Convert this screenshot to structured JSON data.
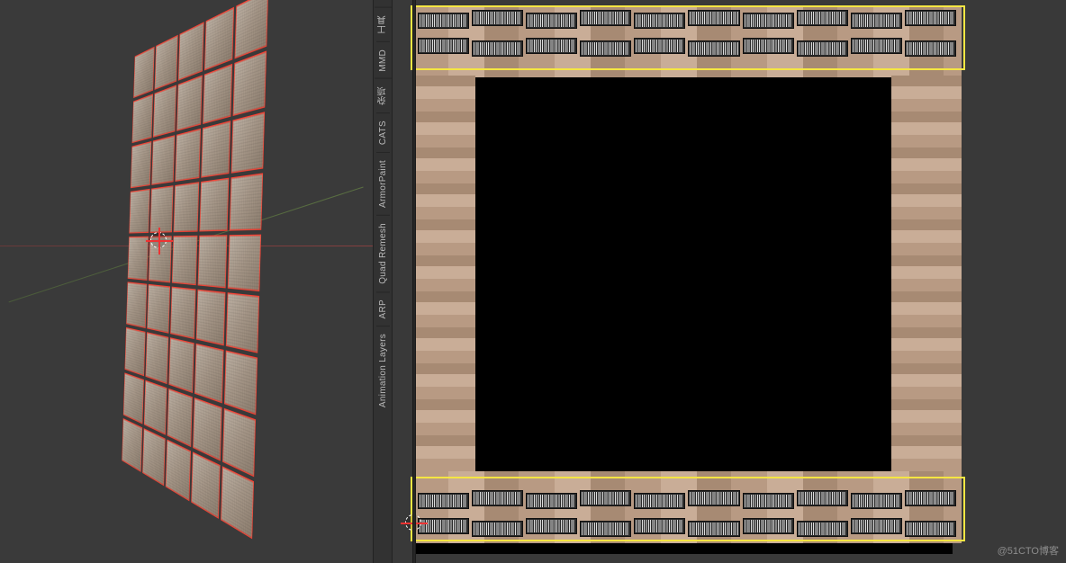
{
  "tabs": [
    "工具",
    "MMD",
    "杂项",
    "CATS",
    "ArmorPaint",
    "Quad Remesh",
    "ARP",
    "Animation Layers"
  ],
  "wall": {
    "rows": 9,
    "cols": 5
  },
  "uv": {
    "highlight_top": true,
    "highlight_bot": true,
    "glyph_segments": 10,
    "glyph_rows": 2
  },
  "watermark": "@51CTO博客"
}
